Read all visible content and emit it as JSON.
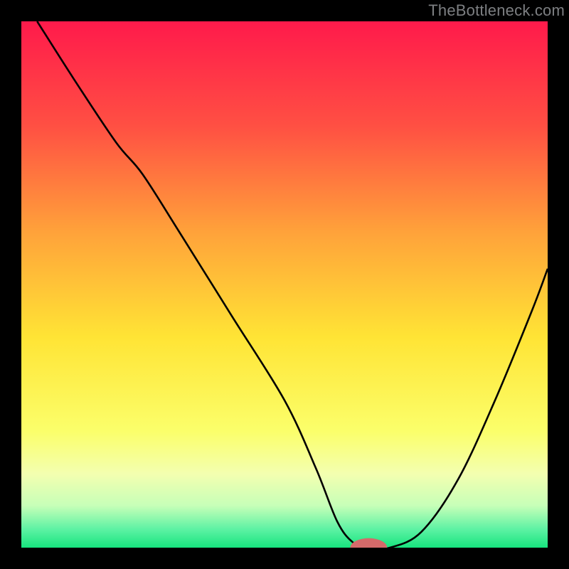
{
  "attribution": "TheBottleneck.com",
  "chart_data": {
    "type": "line",
    "title": "",
    "xlabel": "",
    "ylabel": "",
    "xlim": [
      0,
      100
    ],
    "ylim": [
      0,
      100
    ],
    "series": [
      {
        "name": "curve",
        "x": [
          3,
          10,
          18,
          23,
          30,
          40,
          50,
          56,
          60,
          63,
          66,
          70,
          76,
          83,
          90,
          97,
          100
        ],
        "y": [
          100,
          89,
          77,
          71,
          60,
          44,
          28,
          15,
          5,
          1,
          0,
          0,
          3,
          13,
          28,
          45,
          53
        ]
      }
    ],
    "marker": {
      "x": 66,
      "y": 0,
      "rx": 3.5,
      "ry": 1.8,
      "color": "#d46a6a"
    },
    "gradient_stops": [
      {
        "offset": 0.0,
        "color": "#ff1a4b"
      },
      {
        "offset": 0.2,
        "color": "#ff5043"
      },
      {
        "offset": 0.4,
        "color": "#ffa23a"
      },
      {
        "offset": 0.6,
        "color": "#ffe435"
      },
      {
        "offset": 0.78,
        "color": "#fbff6b"
      },
      {
        "offset": 0.86,
        "color": "#f3ffb0"
      },
      {
        "offset": 0.92,
        "color": "#c7ffb8"
      },
      {
        "offset": 0.965,
        "color": "#5df2a4"
      },
      {
        "offset": 1.0,
        "color": "#17e47e"
      }
    ],
    "curve_stroke": "#000000",
    "curve_width": 2.6
  }
}
